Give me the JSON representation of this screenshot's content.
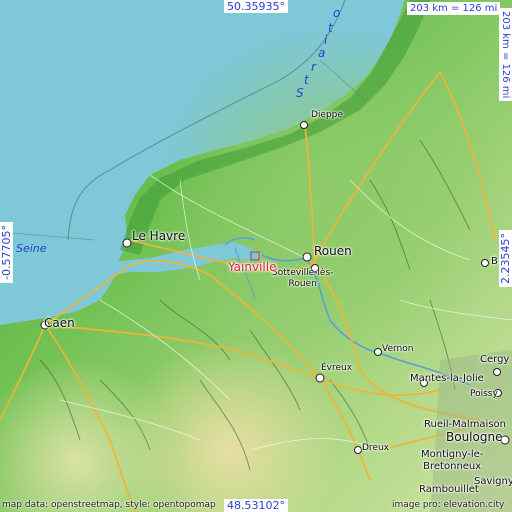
{
  "place": {
    "name": "Yainville",
    "color": "#d6263a"
  },
  "coords": {
    "north": "50.35935°",
    "south": "48.53102°",
    "west": "-0.57705°",
    "east": "2.23545°"
  },
  "scale": {
    "horizontal": "203 km = 126 mi",
    "vertical": "203 km = 126 mi"
  },
  "water_labels": {
    "seine": "Seine",
    "strait_letters": [
      "S",
      "t",
      "r",
      "a",
      "i",
      "t",
      "o"
    ]
  },
  "cities": [
    {
      "id": "dieppe",
      "label": "Dieppe"
    },
    {
      "id": "le-havre",
      "label": "Le Havre"
    },
    {
      "id": "rouen",
      "label": "Rouen"
    },
    {
      "id": "sotteville",
      "label": "Sotteville-lès-\nRouen"
    },
    {
      "id": "caen",
      "label": "Caen"
    },
    {
      "id": "vernon",
      "label": "Vernon"
    },
    {
      "id": "evreux",
      "label": "Évreux"
    },
    {
      "id": "cergy",
      "label": "Cergy"
    },
    {
      "id": "mantes",
      "label": "Mantes-la-Jolie"
    },
    {
      "id": "poissy",
      "label": "Poissy"
    },
    {
      "id": "rueil",
      "label": "Rueil-Malmaison"
    },
    {
      "id": "boulogne",
      "label": "Boulogne"
    },
    {
      "id": "montigny",
      "label": "Montigny-le-\nBretonneux"
    },
    {
      "id": "savigny",
      "label": "Savigny"
    },
    {
      "id": "dreux",
      "label": "Dreux"
    },
    {
      "id": "rambouillet",
      "label": "Rambouillet"
    },
    {
      "id": "beauvais-edge",
      "label": "B"
    }
  ],
  "credits": {
    "left": "map data: openstreetmap, style: opentopomap",
    "right": "image pro: elevation.city"
  },
  "colors": {
    "sea": "#7ec8d8",
    "lowland": "#5fb84a",
    "midland": "#9ed07a",
    "highland": "#cde6a0",
    "upland": "#e5e0a6",
    "road": "#f0b43a",
    "accent": "#2a3fd0"
  }
}
